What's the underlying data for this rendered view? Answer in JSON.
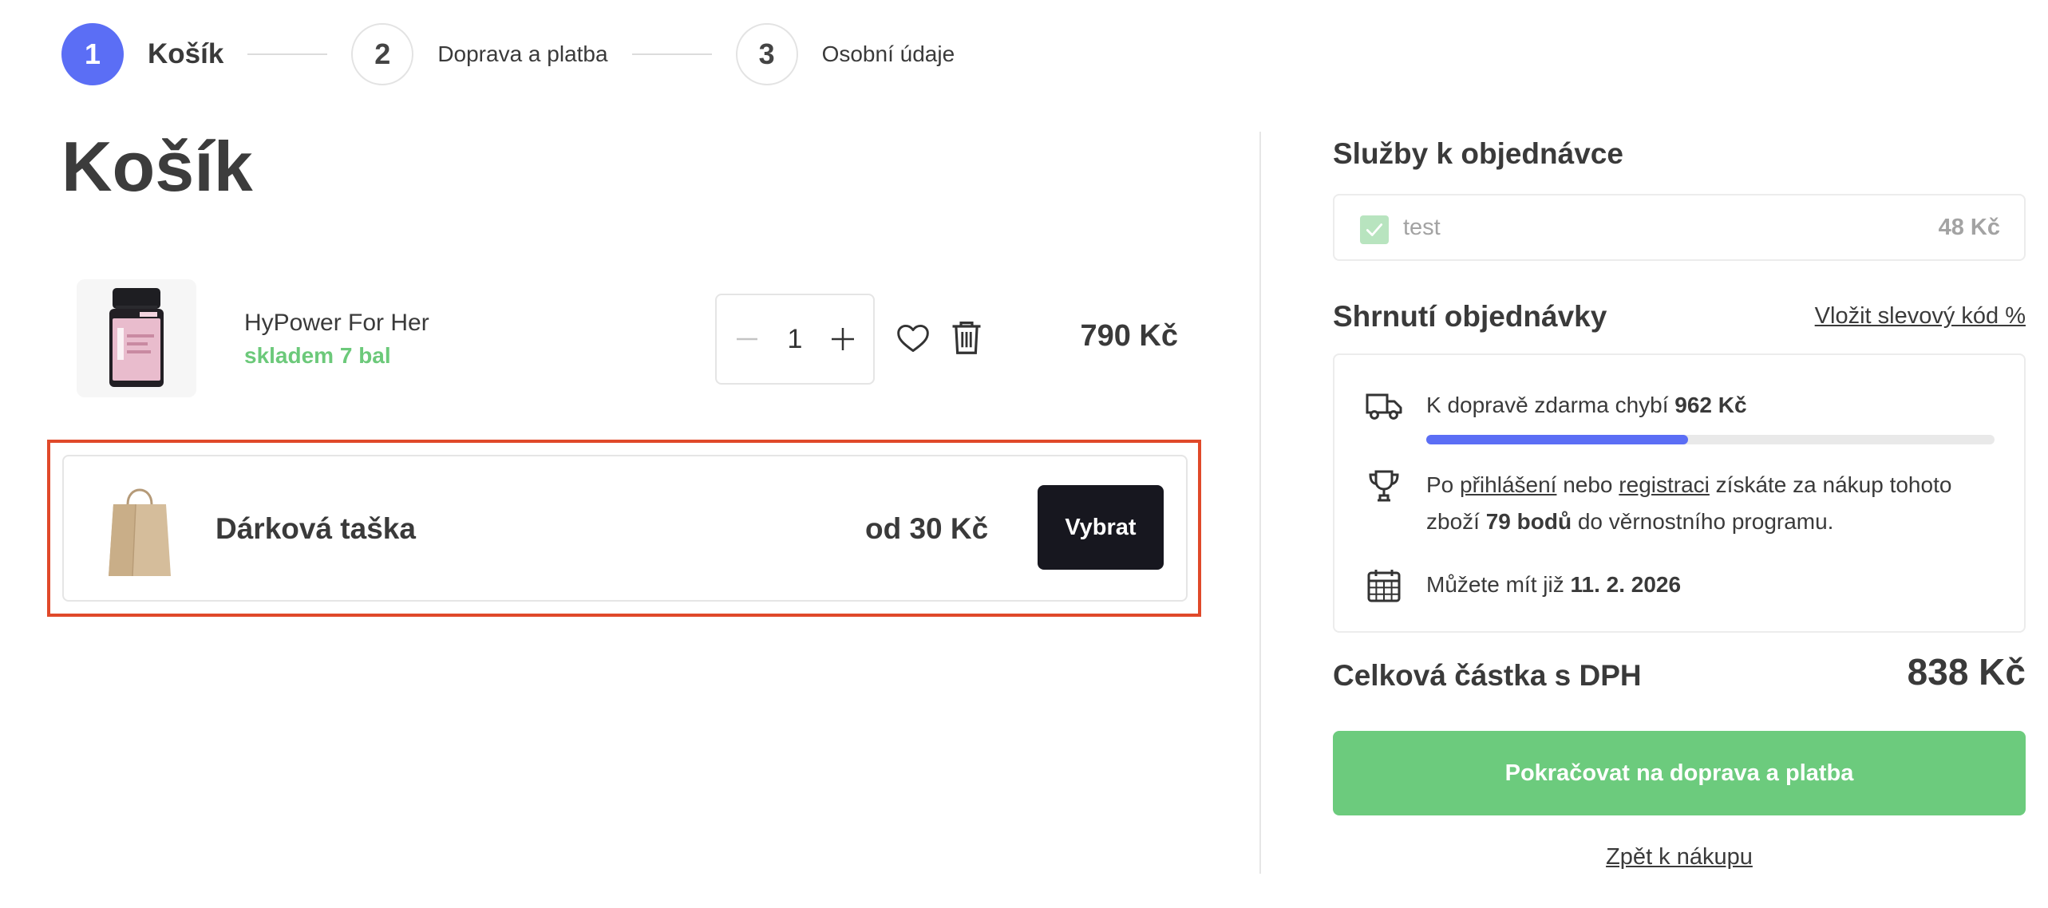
{
  "stepper": {
    "steps": [
      {
        "number": "1",
        "label": "Košík",
        "active": true
      },
      {
        "number": "2",
        "label": "Doprava a platba",
        "active": false
      },
      {
        "number": "3",
        "label": "Osobní údaje",
        "active": false
      }
    ]
  },
  "cart": {
    "title": "Košík",
    "items": [
      {
        "name": "HyPower For Her",
        "stock": "skladem 7 bal",
        "quantity": "1",
        "price": "790 Kč"
      }
    ],
    "gift": {
      "name": "Dárková taška",
      "price": "od 30 Kč",
      "button_label": "Vybrat"
    }
  },
  "services": {
    "title": "Služby k objednávce",
    "items": [
      {
        "name": "test",
        "price": "48 Kč",
        "checked": true
      }
    ]
  },
  "summary": {
    "title": "Shrnutí objednávky",
    "coupon_link": "Vložit slevový kód %",
    "shipping": {
      "prefix": "K dopravě zdarma chybí ",
      "amount": "962 Kč",
      "progress": 0.46
    },
    "loyalty": {
      "text1": "Po ",
      "login_link": "přihlášení",
      "text2": " nebo ",
      "register_link": "registraci",
      "text3": " získáte za nákup tohoto zboží ",
      "points": "79 bodů",
      "text4": " do věrnostního programu."
    },
    "delivery": {
      "prefix": "Můžete mít již ",
      "date": "11. 2. 2026"
    }
  },
  "total": {
    "label": "Celková částka s DPH",
    "value": "838 Kč"
  },
  "actions": {
    "continue_label": "Pokračovat na doprava a platba",
    "back_label": "Zpět k nákupu"
  },
  "colors": {
    "accent": "#5b6ef5",
    "success": "#6ccb7d",
    "stock": "#6cc97a",
    "dark_button": "#17171f",
    "highlight": "#e0492a"
  }
}
